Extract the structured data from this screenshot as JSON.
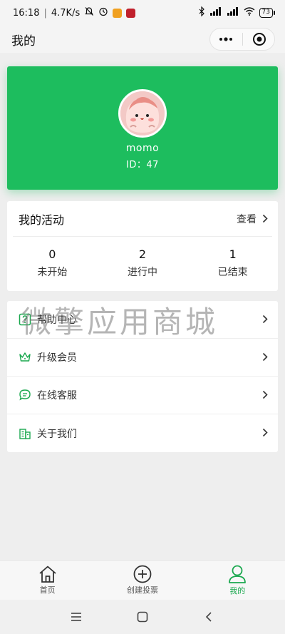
{
  "status_bar": {
    "time": "16:18",
    "speed": "4.7K/s",
    "battery": "73"
  },
  "nav": {
    "title": "我的"
  },
  "profile": {
    "username": "momo",
    "id_text": "ID：47"
  },
  "activity": {
    "title": "我的活动",
    "view_label": "查看",
    "stats": [
      {
        "value": "0",
        "label": "未开始"
      },
      {
        "value": "2",
        "label": "进行中"
      },
      {
        "value": "1",
        "label": "已结束"
      }
    ]
  },
  "menu": {
    "items": [
      {
        "label": "帮助中心",
        "icon": "help-icon"
      },
      {
        "label": "升级会员",
        "icon": "crown-icon"
      },
      {
        "label": "在线客服",
        "icon": "chat-icon"
      },
      {
        "label": "关于我们",
        "icon": "building-icon"
      }
    ]
  },
  "watermark": "微擎应用商城",
  "tabbar": {
    "tabs": [
      {
        "label": "首页",
        "icon": "home-icon"
      },
      {
        "label": "创建投票",
        "icon": "add-circle-icon"
      },
      {
        "label": "我的",
        "icon": "user-icon"
      }
    ]
  },
  "colors": {
    "accent": "#1dbd5e",
    "tab_active": "#1ba84f"
  }
}
